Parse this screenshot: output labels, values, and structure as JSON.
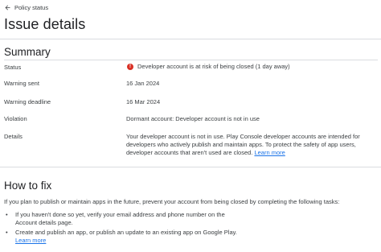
{
  "header": {
    "back_label": "Policy status",
    "title": "Issue details"
  },
  "summary": {
    "heading": "Summary",
    "status_label": "Status",
    "status_value": "Developer account is at risk of being closed (1 day away)",
    "status_icon": "error-icon",
    "status_color": "#d93025",
    "warning_sent_label": "Warning sent",
    "warning_sent_value": "16 Jan 2024",
    "warning_deadline_label": "Warning deadline",
    "warning_deadline_value": "16 Mar 2024",
    "violation_label": "Violation",
    "violation_value": "Dormant account: Developer account is not in use",
    "details_label": "Details",
    "details_text": "Your developer account is not in use. Play Console developer accounts are intended for developers who actively publish and maintain apps. To protect the safety of app users, developer accounts that aren't used are closed.",
    "details_link": "Learn more"
  },
  "how_to_fix": {
    "heading": "How to fix",
    "intro": "If you plan to publish or maintain apps in the future, prevent your account from being closed by completing the following tasks:",
    "tasks": [
      {
        "text": "If you haven't done so yet, verify your email address and phone number on the Account details page."
      },
      {
        "text": "Create and publish an app, or publish an update to an existing app on Google Play.",
        "link": "Learn more"
      }
    ]
  },
  "colors": {
    "link": "#1a73e8",
    "divider": "#dadce0",
    "text": "#3c4043"
  }
}
